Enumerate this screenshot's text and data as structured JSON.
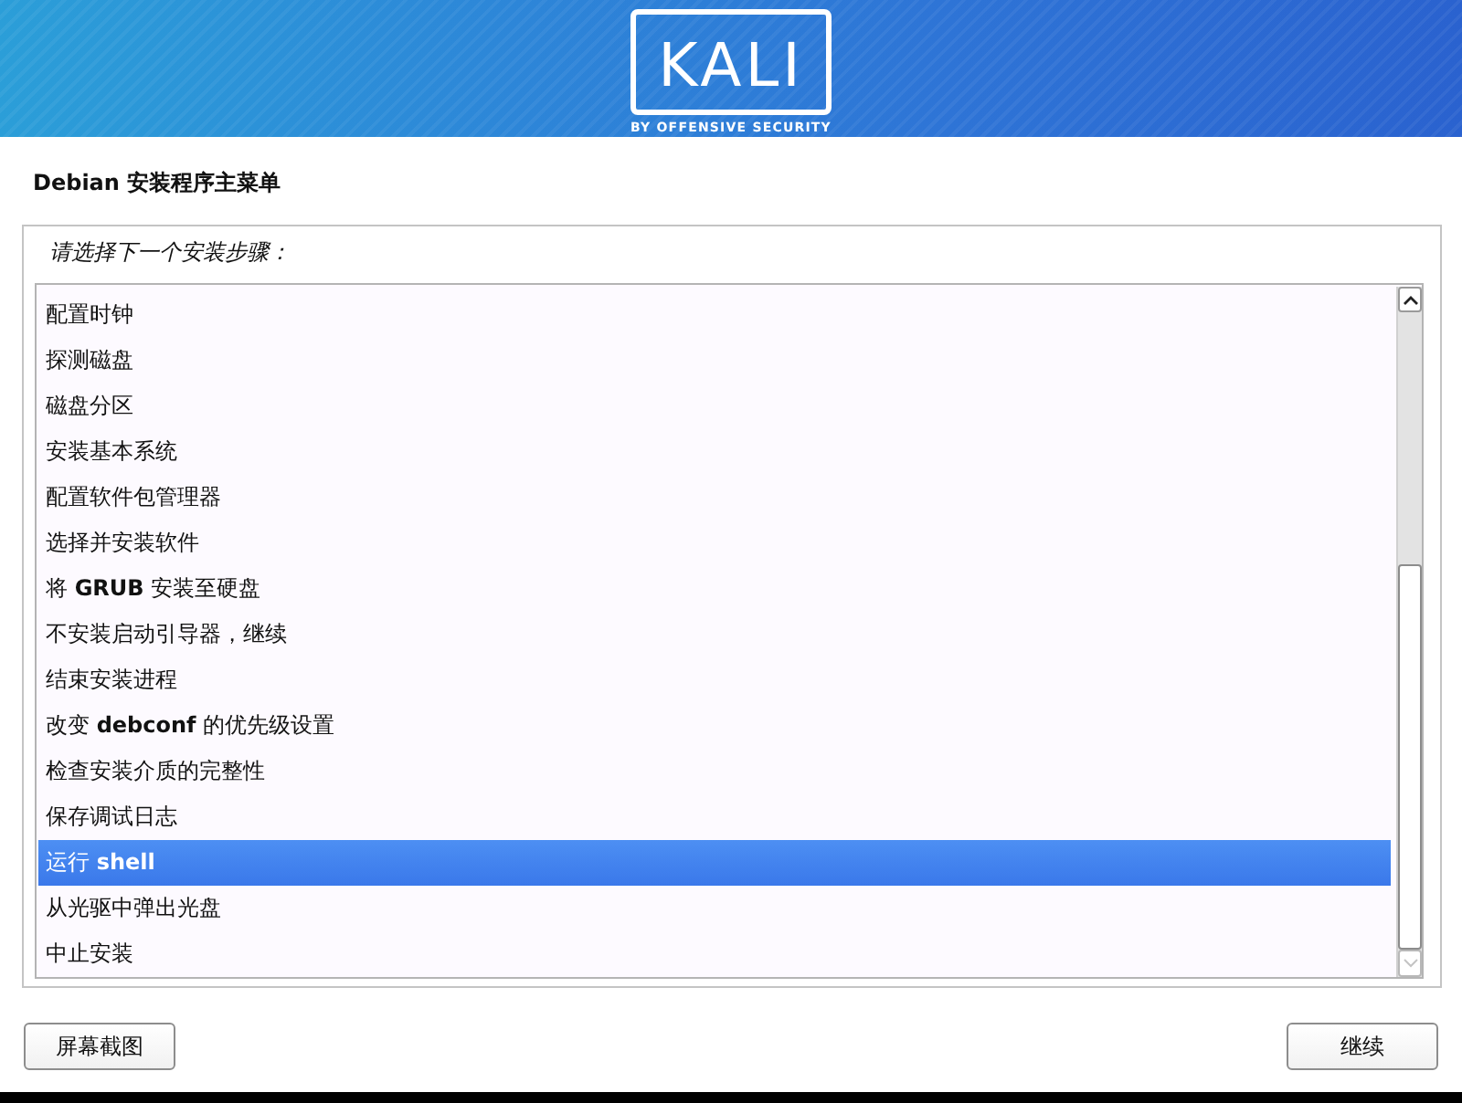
{
  "header": {
    "logo_text": "KALI",
    "logo_tagline": "BY OFFENSIVE SECURITY"
  },
  "title": "Debian 安装程序主菜单",
  "prompt": "请选择下一个安装步骤：",
  "menu": {
    "items": [
      {
        "label": "配置时钟",
        "selected": false
      },
      {
        "label": "探测磁盘",
        "selected": false
      },
      {
        "label": "磁盘分区",
        "selected": false
      },
      {
        "label": "安装基本系统",
        "selected": false
      },
      {
        "label": "配置软件包管理器",
        "selected": false
      },
      {
        "label": "选择并安装软件",
        "selected": false
      },
      {
        "label": "将 **GRUB** 安装至硬盘",
        "selected": false
      },
      {
        "label": "不安装启动引导器，继续",
        "selected": false
      },
      {
        "label": "结束安装进程",
        "selected": false
      },
      {
        "label": "改变 **debconf** 的优先级设置",
        "selected": false
      },
      {
        "label": "检查安装介质的完整性",
        "selected": false
      },
      {
        "label": "保存调试日志",
        "selected": false
      },
      {
        "label": "运行 **shell**",
        "selected": true
      },
      {
        "label": "从光驱中弹出光盘",
        "selected": false
      },
      {
        "label": "中止安装",
        "selected": false
      }
    ]
  },
  "buttons": [
    "屏幕截图",
    "继续"
  ]
}
